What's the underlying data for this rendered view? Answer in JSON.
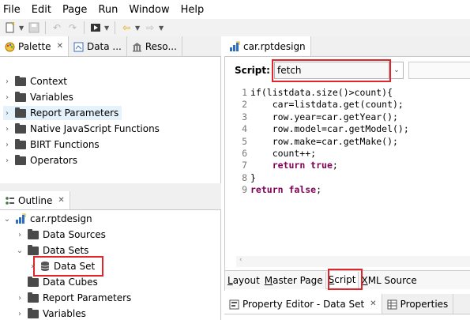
{
  "menu": [
    "File",
    "Edit",
    "Page",
    "Run",
    "Window",
    "Help"
  ],
  "palette_tabs": [
    {
      "label": "Palette",
      "icon": "palette-icon"
    },
    {
      "label": "Data ...",
      "icon": "data-explorer-icon"
    },
    {
      "label": "Reso...",
      "icon": "resource-explorer-icon"
    }
  ],
  "palette_items": [
    "Context",
    "Variables",
    "Report Parameters",
    "Native JavaScript Functions",
    "BIRT Functions",
    "Operators"
  ],
  "outline": {
    "tab_label": "Outline",
    "root": "car.rptdesign",
    "items": {
      "data_sources": "Data Sources",
      "data_sets": "Data Sets",
      "data_set": "Data Set",
      "data_cubes": "Data Cubes",
      "report_parameters": "Report Parameters",
      "variables": "Variables"
    }
  },
  "editor": {
    "tab_label": "car.rptdesign",
    "script_label": "Script:",
    "script_event": "fetch",
    "code": [
      {
        "n": "1",
        "parts": [
          {
            "t": "if(listdata.size()>count){"
          }
        ]
      },
      {
        "n": "2",
        "parts": [
          {
            "t": "    car=listdata.get(count);"
          }
        ]
      },
      {
        "n": "3",
        "parts": [
          {
            "t": "    row.year=car.getYear();"
          }
        ]
      },
      {
        "n": "4",
        "parts": [
          {
            "t": "    row.model=car.getModel();"
          }
        ]
      },
      {
        "n": "5",
        "parts": [
          {
            "t": "    row.make=car.getMake();"
          }
        ]
      },
      {
        "n": "6",
        "parts": [
          {
            "t": "    count++;"
          }
        ]
      },
      {
        "n": "7",
        "parts": [
          {
            "t": "    "
          },
          {
            "t": "return true",
            "kw": true
          },
          {
            "t": ";"
          }
        ]
      },
      {
        "n": "8",
        "parts": [
          {
            "t": "}"
          }
        ]
      },
      {
        "n": "9",
        "parts": [
          {
            "t": "return false",
            "kw": true
          },
          {
            "t": ";"
          }
        ]
      }
    ],
    "page_tabs": [
      {
        "label": "Layout",
        "u": "L",
        "rest": "ayout"
      },
      {
        "label": "Master Page",
        "u": "M",
        "rest": "aster Page"
      },
      {
        "label": "Script",
        "u": "S",
        "rest": "cript"
      },
      {
        "label": "XML Source",
        "u": "X",
        "rest": "ML Source"
      }
    ]
  },
  "bottom_tabs": [
    {
      "label": "Property Editor - Data Set",
      "icon": "property-editor-icon"
    },
    {
      "label": "Properties",
      "icon": "properties-icon"
    }
  ],
  "colors": {
    "highlight": "#e0262b",
    "keyword": "#7f0055",
    "selection": "#e5f1fb"
  }
}
